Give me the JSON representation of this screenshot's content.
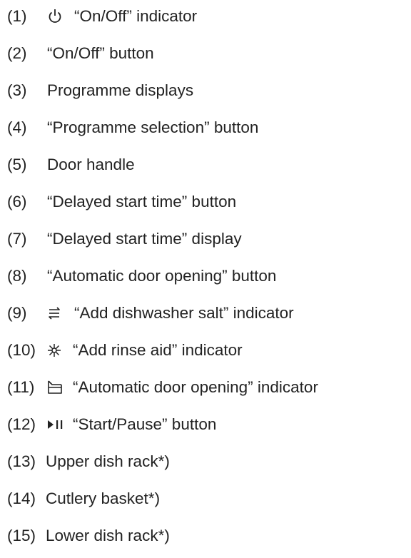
{
  "items": [
    {
      "num": "(1)",
      "icon": "power-icon",
      "text": "“On/Off” indicator"
    },
    {
      "num": "(2)",
      "icon": null,
      "text": "“On/Off” button"
    },
    {
      "num": "(3)",
      "icon": null,
      "text": "Programme displays"
    },
    {
      "num": "(4)",
      "icon": null,
      "text": "“Programme selection” button"
    },
    {
      "num": "(5)",
      "icon": null,
      "text": "Door handle"
    },
    {
      "num": "(6)",
      "icon": null,
      "text": "“Delayed start time” button"
    },
    {
      "num": "(7)",
      "icon": null,
      "text": "“Delayed start time” display"
    },
    {
      "num": "(8)",
      "icon": null,
      "text": "“Automatic door opening” button"
    },
    {
      "num": "(9)",
      "icon": "salt-icon",
      "text": "“Add dishwasher salt” indicator"
    },
    {
      "num": "(10)",
      "icon": "rinse-aid-icon",
      "text": "“Add rinse aid” indicator"
    },
    {
      "num": "(11)",
      "icon": "door-opening-icon",
      "text": "“Automatic door opening” indicator"
    },
    {
      "num": "(12)",
      "icon": "start-pause-icon",
      "text": "“Start/Pause” button"
    },
    {
      "num": "(13)",
      "icon": null,
      "text": "Upper dish rack*)"
    },
    {
      "num": "(14)",
      "icon": null,
      "text": "Cutlery basket*)"
    },
    {
      "num": "(15)",
      "icon": null,
      "text": "Lower dish rack*)"
    }
  ]
}
